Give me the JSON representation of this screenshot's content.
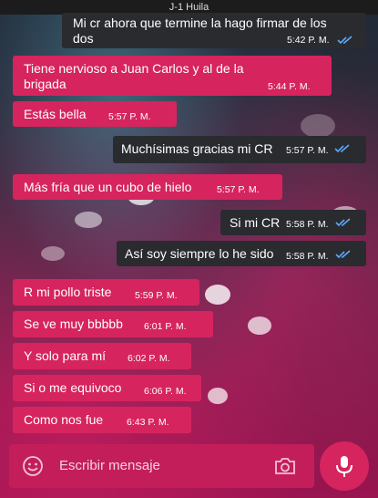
{
  "header": {
    "title": "J-1 Huila"
  },
  "messages": [
    {
      "dir": "out",
      "text": "Mi cr ahora que termine la hago firmar de los dos",
      "time": "5:42 P. M."
    },
    {
      "dir": "in",
      "text": "Tiene nervioso a Juan Carlos y al de la brigada",
      "time": "5:44 P. M."
    },
    {
      "dir": "in",
      "text": "Estás bella",
      "time": "5:57 P. M."
    },
    {
      "dir": "out",
      "text": "Muchísimas gracias mi CR",
      "time": "5:57 P. M."
    },
    {
      "dir": "in",
      "text": "Más fría que un cubo de hielo",
      "time": "5:57 P. M."
    },
    {
      "dir": "out",
      "text": "Si mi CR",
      "time": "5:58 P. M."
    },
    {
      "dir": "out",
      "text": "Así soy siempre lo he sido",
      "time": "5:58 P. M."
    },
    {
      "dir": "in",
      "text": "R mi pollo triste",
      "time": "5:59 P. M."
    },
    {
      "dir": "in",
      "text": "Se ve muy bbbbb",
      "time": "6:01 P. M."
    },
    {
      "dir": "in",
      "text": "Y solo para mí",
      "time": "6:02 P. M."
    },
    {
      "dir": "in",
      "text": "Si o me equivoco",
      "time": "6:06 P. M."
    },
    {
      "dir": "in",
      "text": "Como nos fue",
      "time": "6:43 P. M."
    }
  ],
  "composer": {
    "placeholder": "Escribir mensaje"
  },
  "icons": {
    "emoji": "emoji-icon",
    "camera": "camera-icon",
    "mic": "mic-icon",
    "ticks": "double-check-icon"
  },
  "colors": {
    "incoming": "#d6245f",
    "outgoing": "#2a2b2f",
    "check": "#5aa9ff"
  }
}
